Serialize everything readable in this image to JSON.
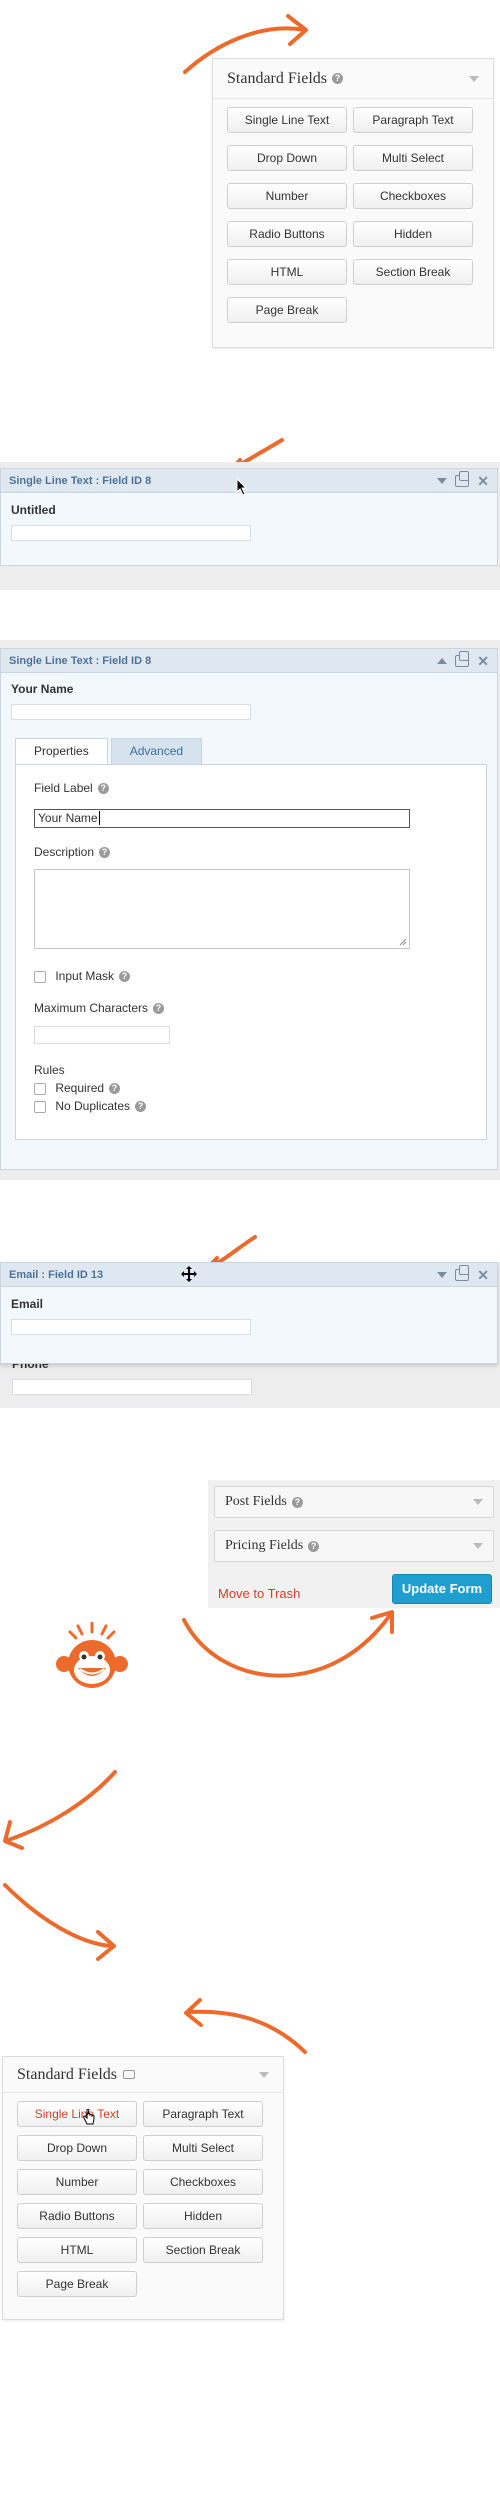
{
  "colors": {
    "accent_arrow": "#ec6a2c",
    "field_bar": "#dfe8f1",
    "field_title": "#4d7399",
    "update_button": "#1f9fcf",
    "trash_link": "#d2402a"
  },
  "panel1": {
    "title": "Standard Fields",
    "buttons": [
      "Single Line Text",
      "Paragraph Text",
      "Drop Down",
      "Multi Select",
      "Number",
      "Checkboxes",
      "Radio Buttons",
      "Hidden",
      "HTML",
      "Section Break",
      "Page Break"
    ]
  },
  "field_box1": {
    "title": "Single Line Text : Field ID 8",
    "label": "Untitled"
  },
  "field_box2": {
    "title": "Single Line Text : Field ID 8",
    "label": "Your Name",
    "tabs": [
      "Properties",
      "Advanced"
    ],
    "field_label_caption": "Field Label",
    "field_label_value": "Your Name",
    "description_caption": "Description",
    "input_mask_label": "Input Mask",
    "max_chars_caption": "Maximum Characters",
    "rules_caption": "Rules",
    "required_label": "Required",
    "no_duplicates_label": "No Duplicates"
  },
  "field_box3": {
    "title": "Email : Field ID 13",
    "label": "Email",
    "next_label": "Phone"
  },
  "sidebar_bottom": {
    "post_fields": "Post Fields",
    "pricing_fields": "Pricing Fields",
    "trash": "Move to Trash",
    "update": "Update Form"
  },
  "panel2": {
    "title": "Standard Fields",
    "buttons": [
      "Single Line Text",
      "Paragraph Text",
      "Drop Down",
      "Multi Select",
      "Number",
      "Checkboxes",
      "Radio Buttons",
      "Hidden",
      "HTML",
      "Section Break",
      "Page Break"
    ]
  },
  "icons": [
    "help-icon",
    "collapse-arrow-icon",
    "duplicate-icon",
    "delete-icon",
    "move-cursor-icon",
    "pointer-cursor-icon",
    "monkey-face-icon",
    "speech-bubble-icon"
  ]
}
